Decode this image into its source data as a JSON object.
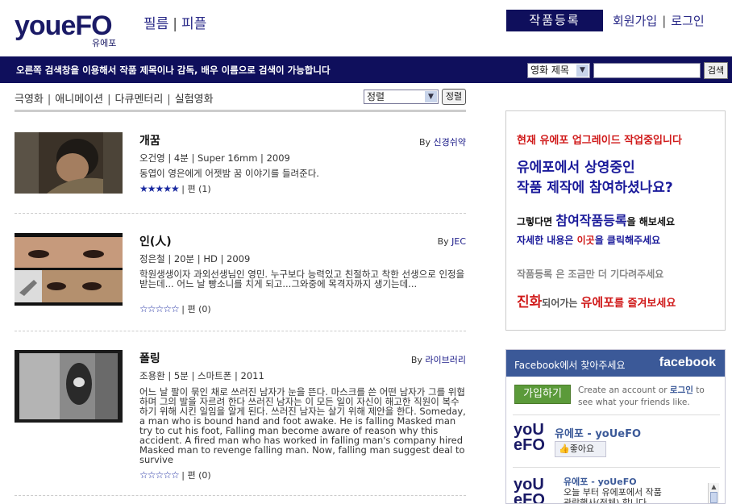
{
  "header": {
    "logo_text": "youeFO",
    "logo_sub": "유에포",
    "nav": [
      "필름",
      "피플"
    ],
    "register": "작품등록",
    "user_links": [
      "회원가입",
      "로그인"
    ]
  },
  "searchbar": {
    "message": "오른쪽 검색창을 이용해서 작품 제목이나 감독, 배우 이름으로 검색이 가능합니다",
    "select_value": "영화 제목",
    "button": "검색"
  },
  "categories": [
    "극영화",
    "애니메이션",
    "다큐멘터리",
    "실험영화"
  ],
  "sort": {
    "select_value": "정렬",
    "button": "정렬"
  },
  "films": [
    {
      "title": "개꿈",
      "by_prefix": "By",
      "director": "신경쉬약",
      "meta": "오건영 | 4분 | Super 16mm | 2009",
      "desc": "동엽이 영은에게 어젯밤 꿈 이야기를 들려준다.",
      "stars": "★★★★★",
      "review": "| 편 (1)"
    },
    {
      "title": "인(人)",
      "by_prefix": "By",
      "director": "JEC",
      "meta": "정은철 | 20분 | HD | 2009",
      "desc": "학원생생이자 과외선생님인 영민. 누구보다 능력있고 친절하고 착한 선생으로 인정을 받는데... 어느 날 빵소니를 치게 되고...그와중에 목격자까지 생기는데...",
      "stars": "☆☆☆☆☆",
      "review": "| 편 (0)"
    },
    {
      "title": "폴링",
      "by_prefix": "By",
      "director": "라이브러리",
      "meta": "조용환 | 5분 | 스마트폰 | 2011",
      "desc": "어느 날 팔이 묶인 채로 쓰러진 남자가 눈을 뜬다. 마스크를 쓴 어떤 남자가 그를 위협하며 그의 발을 자르려 한다 쓰러진 남자는 이 모든 일이 자신이 해고한 직원이 복수하기 위해 시킨 일임을 알게 된다. 쓰러진 남자는 살기 위해 제안을 한다. Someday, a man who is bound hand and foot awake. He is falling Masked man try to cut his foot, Falling man become aware of reason why this accident. A fired man who has worked in falling man's company hired Masked man to revenge falling man. Now, falling man suggest deal to survive",
      "stars": "☆☆☆☆☆",
      "review": "| 편 (0)"
    }
  ],
  "promo": {
    "line1": "현재 유에포 업그레이드 작업중입니다",
    "line2a": "유에포에서 상영중인",
    "line2b": "작품 제작에 참여하셨나요?",
    "line3_pre": "그렇다면 ",
    "line3_big": "참여작품등록",
    "line3_post": "을 해보세요",
    "line4_pre": "자세한 내용은 ",
    "line4_red": "이곳",
    "line4_post": "을 클릭해주세요",
    "line5": "작품등록 은 조금만 더 기다려주세요",
    "line6_a": "진화",
    "line6_b": "되어가는 ",
    "line6_c": "유에포",
    "line6_d": "를 즐겨보세요"
  },
  "facebook": {
    "head": "Facebook에서 찾아주세요",
    "brand": "facebook",
    "join": "가입하기",
    "note_a": "Create an account or ",
    "note_login": "로그인",
    "note_b": " to see what your friends like.",
    "page_name": "유에포 - yoUeFO",
    "like": "좋아요",
    "post_name": "유에포 - yoUeFO",
    "post_text": "오늘 부터 유에포에서 작품 관람행사(전체) 합니다"
  },
  "colors": {
    "navy": "#0f0f5c",
    "fb_blue": "#3b5998",
    "promo_red": "#d01a1a"
  }
}
